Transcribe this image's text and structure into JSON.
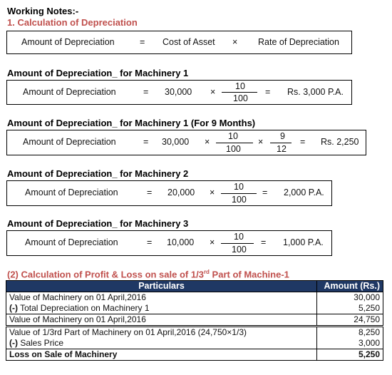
{
  "working_notes_title": "Working Notes:-",
  "section1": {
    "title": "1. Calculation of Depreciation",
    "formula": {
      "lhs": "Amount of Depreciation",
      "eq": "=",
      "term1": "Cost of Asset",
      "times": "×",
      "term2": "Rate of Depreciation"
    },
    "machinery": [
      {
        "heading": "Amount of Depreciation_ for Machinery 1",
        "lhs": "Amount of Depreciation",
        "eq": "=",
        "base": "30,000",
        "times": "×",
        "fractions": [
          {
            "num": "10",
            "den": "100"
          }
        ],
        "result_eq": "=",
        "result": "Rs. 3,000 P.A."
      },
      {
        "heading": "Amount of Depreciation_ for Machinery 1 (For 9 Months)",
        "lhs": "Amount of Depreciation",
        "eq": "=",
        "base": "30,000",
        "times": "×",
        "fractions": [
          {
            "num": "10",
            "den": "100"
          },
          {
            "num": "9",
            "den": "12"
          }
        ],
        "times2": "×",
        "result_eq": "=",
        "result": "Rs. 2,250"
      },
      {
        "heading": "Amount of Depreciation_ for Machinery 2",
        "lhs": "Amount of Depreciation",
        "eq": "=",
        "base": "20,000",
        "times": "×",
        "fractions": [
          {
            "num": "10",
            "den": "100"
          }
        ],
        "result_eq": "=",
        "result": "2,000 P.A."
      },
      {
        "heading": "Amount of Depreciation_ for Machinery 3",
        "lhs": "Amount of Depreciation",
        "eq": "=",
        "base": "10,000",
        "times": "×",
        "fractions": [
          {
            "num": "10",
            "den": "100"
          }
        ],
        "result_eq": "=",
        "result": "1,000 P.A."
      }
    ]
  },
  "section2": {
    "title_prefix": "(2) Calculation of Profit & Loss on sale of 1/3",
    "title_sup": "rd",
    "title_suffix": " Part of Machine-1",
    "header": {
      "particulars": "Particulars",
      "amount": "Amount (Rs.)"
    },
    "rows": [
      {
        "prefix": "",
        "text": "Value of Machinery on 01 April,2016",
        "amount": "30,000"
      },
      {
        "prefix": "(-)",
        "text": " Total Depreciation on Machinery 1",
        "amount": "5,250"
      },
      {
        "prefix": "",
        "text": "Value of Machinery on 01 April,2016",
        "amount": "24,750"
      },
      {
        "prefix": "",
        "text": "Value of 1/3rd Part of Machinery on 01 April,2016 (24,750×1/3)",
        "amount": "8,250"
      },
      {
        "prefix": "(-)",
        "text": " Sales Price",
        "amount": "3,000"
      },
      {
        "prefix": "",
        "text": "Loss on Sale of Machinery",
        "amount": "5,250"
      }
    ]
  },
  "colors": {
    "heading_red": "#c0504d",
    "table_header_bg": "#1f3864"
  }
}
